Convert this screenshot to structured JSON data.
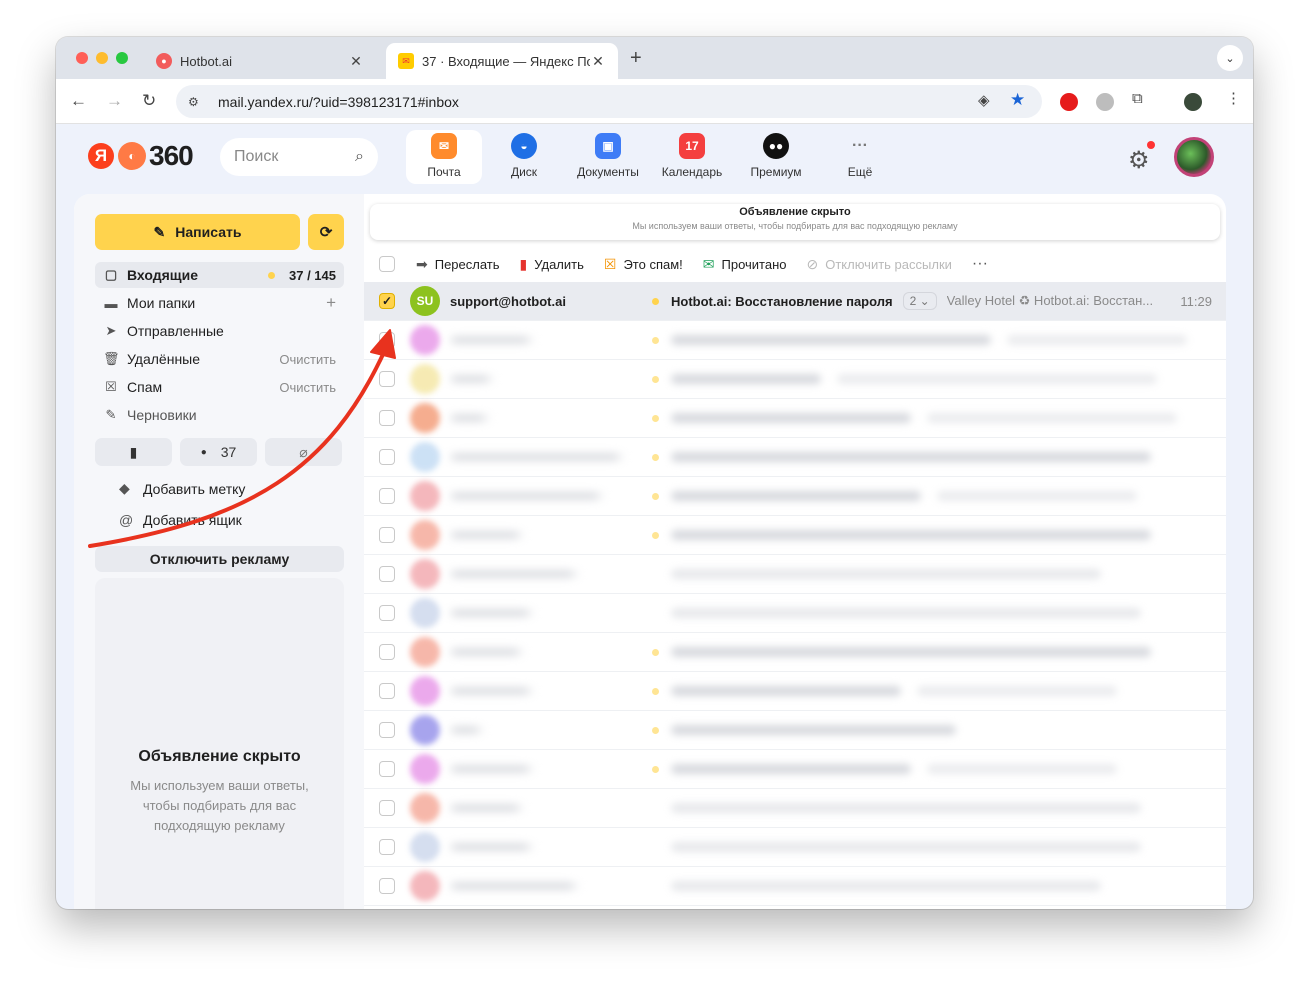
{
  "browser": {
    "tabs": [
      {
        "title": "Hotbot.ai",
        "active": false
      },
      {
        "title": "37 · Входящие — Яндекс По",
        "active": true
      }
    ],
    "url": "mail.yandex.ru/?uid=398123171#inbox"
  },
  "header": {
    "logo_text": "360",
    "search_placeholder": "Поиск",
    "services": [
      {
        "label": "Почта",
        "color": "#ff8b2c"
      },
      {
        "label": "Диск",
        "color": "#1f6fe5"
      },
      {
        "label": "Документы",
        "color": "#3e7cf6"
      },
      {
        "label": "Календарь",
        "color": "#f43f3f",
        "badge": "17"
      },
      {
        "label": "Премиум",
        "color": "#111111"
      },
      {
        "label": "Ещё",
        "color": "#ffffff"
      }
    ]
  },
  "sidebar": {
    "compose_label": "Написать",
    "folders": [
      {
        "label": "Входящие",
        "right": "37 / 145",
        "icon": "inbox-icon"
      },
      {
        "label": "Мои папки",
        "right": "+",
        "icon": "folder-icon"
      },
      {
        "label": "Отправленные",
        "right": "",
        "icon": "sent-icon"
      },
      {
        "label": "Удалённые",
        "right": "Очистить",
        "icon": "trash-icon"
      },
      {
        "label": "Спам",
        "right": "Очистить",
        "icon": "spam-icon"
      },
      {
        "label": "Черновики",
        "right": "",
        "icon": "draft-icon"
      }
    ],
    "unread_filter": "37",
    "add_label": "Добавить метку",
    "add_mailbox": "Добавить ящик",
    "disable_ads": "Отключить рекламу",
    "ad_title": "Объявление скрыто",
    "ad_text": "Мы используем ваши ответы, чтобы подбирать для вас подходящую рекламу"
  },
  "main": {
    "top_ad_title": "Объявление скрыто",
    "top_ad_text": "Мы используем ваши ответы, чтобы подбирать для вас подходящую рекламу",
    "actions": {
      "forward": "Переслать",
      "delete": "Удалить",
      "spam": "Это спам!",
      "read": "Прочитано",
      "unsubscribe": "Отключить рассылки"
    },
    "selected_email": {
      "avatar": "SU",
      "from": "support@hotbot.ai",
      "subject": "Hotbot.ai: Восстановление пароля",
      "thread_count": "2",
      "snippet": "Valley Hotel ♻ Hotbot.ai: Восстан...",
      "time": "11:29"
    }
  },
  "colors": {
    "accent": "#ffd34d",
    "arrow": "#e8321e"
  }
}
